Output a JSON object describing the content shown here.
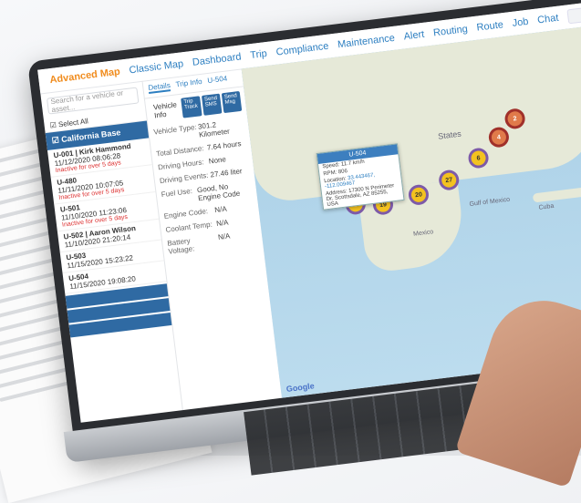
{
  "topnav": {
    "items": [
      "Advanced Map",
      "Classic Map",
      "Dashboard",
      "Trip",
      "Compliance",
      "Maintenance",
      "Alert",
      "Routing",
      "Route",
      "Job",
      "Chat"
    ]
  },
  "left": {
    "search_placeholder": "Search for a vehicle or asset...",
    "select_all": "Select All",
    "group": "California Base",
    "vehicles": [
      {
        "unit": "U-001 | Kirk Hammond",
        "time": "11/12/2020 08:06:28",
        "status": "Inactive for over 5 days"
      },
      {
        "unit": "U-480",
        "time": "11/11/2020 10:07:05",
        "status": "Inactive for over 5 days"
      },
      {
        "unit": "U-501",
        "time": "11/10/2020 11:23:06",
        "status": "Inactive for over 5 days"
      },
      {
        "unit": "U-502 | Aaron Wilson",
        "time": "11/10/2020 21:20:14",
        "status": ""
      },
      {
        "unit": "U-503",
        "time": "11/15/2020 15:23:22",
        "status": ""
      },
      {
        "unit": "U-504",
        "time": "11/15/2020 19:08:20",
        "status": ""
      }
    ]
  },
  "details": {
    "unit_title": "U-504",
    "tabs": [
      "Details",
      "Trip Info"
    ],
    "section": "Vehicle Info",
    "buttons": [
      "Trip Track",
      "Send SMS",
      "Send Msg"
    ],
    "fields": [
      {
        "label": "Vehicle Type:",
        "value": "301.2 Kilometer"
      },
      {
        "label": "Total Distance:",
        "value": "7.64 hours"
      },
      {
        "label": "Driving Hours:",
        "value": "None"
      },
      {
        "label": "Driving Events:",
        "value": "27.46 liter"
      },
      {
        "label": "Fuel Use:",
        "value": "Good, No Engine Code"
      },
      {
        "label": "Engine Code:",
        "value": "N/A"
      },
      {
        "label": "Coolant Temp:",
        "value": "N/A"
      },
      {
        "label": "Battery Voltage:",
        "value": "N/A"
      }
    ]
  },
  "map": {
    "popup_title": "U-504",
    "popup_rows": [
      {
        "label": "Speed:",
        "value": "11.7 km/h"
      },
      {
        "label": "RPM:",
        "value": "806"
      },
      {
        "label": "Location:",
        "value": "33.443467, -112.009467"
      },
      {
        "label": "Address:",
        "value": "17300 N Perimeter Dr, Scottsdale, AZ 85255, USA"
      }
    ],
    "labels": [
      "States",
      "Mexico",
      "Cuba",
      "Gulf of Mexico"
    ],
    "clusters": [
      "23",
      "19",
      "20",
      "27",
      "6",
      "4",
      "2"
    ],
    "zoom_in": "+",
    "zoom_out": "−",
    "google": "Google"
  }
}
